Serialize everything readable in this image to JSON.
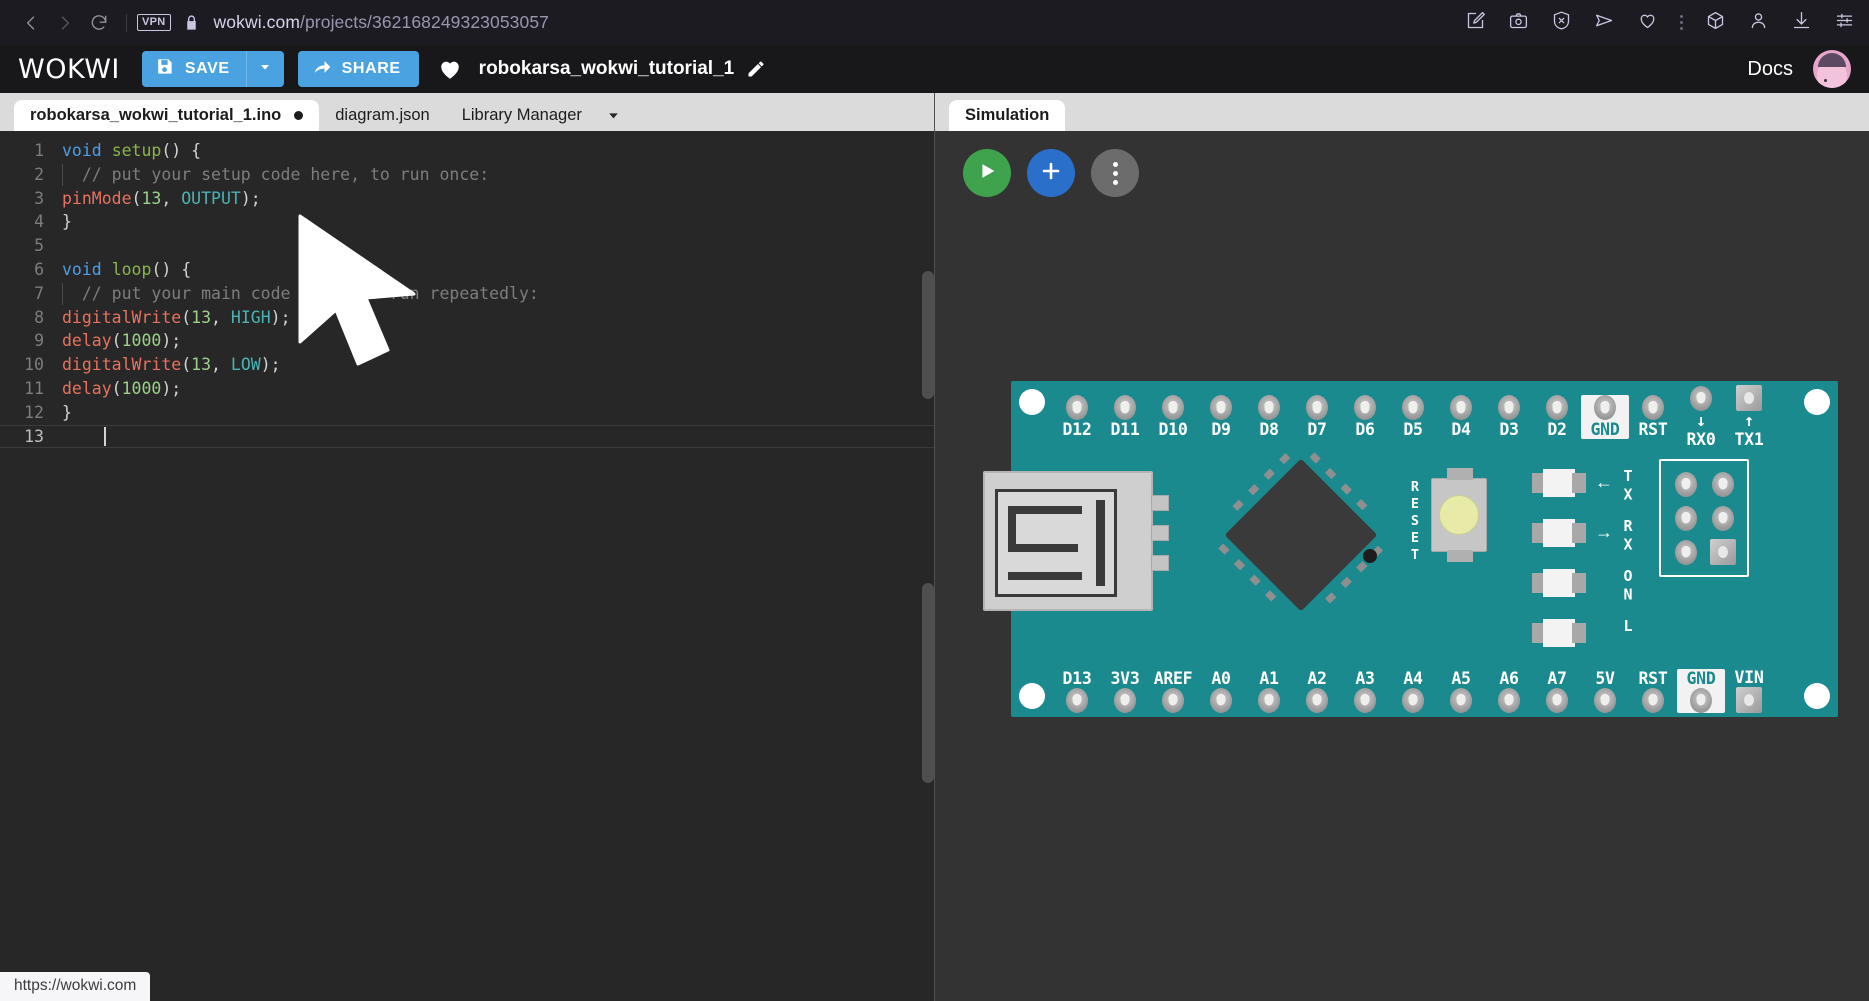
{
  "browser": {
    "url_prefix": "wokwi.com",
    "url_path": "/projects/362168249323053057",
    "vpn_badge": "VPN",
    "back_icon": "back-arrow-icon",
    "forward_icon": "forward-arrow-icon",
    "reload_icon": "reload-icon",
    "lock_icon": "lock-icon",
    "toolbar_icons": [
      "bookmark-edit-icon",
      "camera-icon",
      "blocked-circle-icon",
      "send-icon",
      "heart-icon",
      "overflow-dots-icon",
      "cube-icon",
      "account-icon",
      "download-icon",
      "settings-sliders-icon"
    ],
    "status_url": "https://wokwi.com"
  },
  "header": {
    "logo": "WOKWI",
    "save_label": "SAVE",
    "save_icon": "floppy-disk-icon",
    "save_caret_icon": "chevron-down-icon",
    "share_label": "SHARE",
    "share_icon": "share-arrow-icon",
    "favorite_icon": "heart-filled-icon",
    "project_title": "robokarsa_wokwi_tutorial_1",
    "edit_icon": "pencil-icon",
    "docs_label": "Docs",
    "avatar": "user-avatar"
  },
  "editor_tabs": {
    "items": [
      {
        "label": "robokarsa_wokwi_tutorial_1.ino",
        "active": true,
        "dirty": true
      },
      {
        "label": "diagram.json",
        "active": false,
        "dirty": false
      },
      {
        "label": "Library Manager",
        "active": false,
        "dirty": false
      }
    ],
    "overflow_icon": "chevron-down-icon"
  },
  "code": {
    "lines": [
      {
        "n": "1",
        "tokens": [
          {
            "t": "void",
            "c": "kw"
          },
          {
            "t": " ",
            "c": "pln"
          },
          {
            "t": "setup",
            "c": "fn"
          },
          {
            "t": "() {",
            "c": "pln"
          }
        ]
      },
      {
        "n": "2",
        "indent": true,
        "tokens": [
          {
            "t": "  // put your setup code here, to run once:",
            "c": "cmt"
          }
        ]
      },
      {
        "n": "3",
        "tokens": [
          {
            "t": "pinMode",
            "c": "call"
          },
          {
            "t": "(",
            "c": "pln"
          },
          {
            "t": "13",
            "c": "num"
          },
          {
            "t": ", ",
            "c": "pln"
          },
          {
            "t": "OUTPUT",
            "c": "cst"
          },
          {
            "t": ");",
            "c": "pln"
          }
        ]
      },
      {
        "n": "4",
        "tokens": [
          {
            "t": "}",
            "c": "pln"
          }
        ]
      },
      {
        "n": "5",
        "tokens": []
      },
      {
        "n": "6",
        "tokens": [
          {
            "t": "void",
            "c": "kw"
          },
          {
            "t": " ",
            "c": "pln"
          },
          {
            "t": "loop",
            "c": "fn"
          },
          {
            "t": "() {",
            "c": "pln"
          }
        ]
      },
      {
        "n": "7",
        "indent": true,
        "tokens": [
          {
            "t": "  // put your main code here, to run repeatedly:",
            "c": "cmt"
          }
        ]
      },
      {
        "n": "8",
        "tokens": [
          {
            "t": "digitalWrite",
            "c": "call"
          },
          {
            "t": "(",
            "c": "pln"
          },
          {
            "t": "13",
            "c": "num"
          },
          {
            "t": ", ",
            "c": "pln"
          },
          {
            "t": "HIGH",
            "c": "cst"
          },
          {
            "t": ");",
            "c": "pln"
          }
        ]
      },
      {
        "n": "9",
        "tokens": [
          {
            "t": "delay",
            "c": "call"
          },
          {
            "t": "(",
            "c": "pln"
          },
          {
            "t": "1000",
            "c": "num"
          },
          {
            "t": ");",
            "c": "pln"
          }
        ]
      },
      {
        "n": "10",
        "tokens": [
          {
            "t": "digitalWrite",
            "c": "call"
          },
          {
            "t": "(",
            "c": "pln"
          },
          {
            "t": "13",
            "c": "num"
          },
          {
            "t": ", ",
            "c": "pln"
          },
          {
            "t": "LOW",
            "c": "cst"
          },
          {
            "t": ");",
            "c": "pln"
          }
        ]
      },
      {
        "n": "11",
        "tokens": [
          {
            "t": "delay",
            "c": "call"
          },
          {
            "t": "(",
            "c": "pln"
          },
          {
            "t": "1000",
            "c": "num"
          },
          {
            "t": ");",
            "c": "pln"
          }
        ]
      },
      {
        "n": "12",
        "tokens": [
          {
            "t": "}",
            "c": "pln"
          }
        ]
      },
      {
        "n": "13",
        "current": true,
        "tokens": []
      }
    ]
  },
  "simulation": {
    "tab_label": "Simulation",
    "play_icon": "play-triangle-icon",
    "add_icon": "plus-icon",
    "more_icon": "vertical-dots-icon",
    "board": {
      "name": "arduino-nano",
      "top_pins": [
        {
          "label": "D12"
        },
        {
          "label": "D11"
        },
        {
          "label": "D10"
        },
        {
          "label": "D9"
        },
        {
          "label": "D8"
        },
        {
          "label": "D7"
        },
        {
          "label": "D6"
        },
        {
          "label": "D5"
        },
        {
          "label": "D4"
        },
        {
          "label": "D3"
        },
        {
          "label": "D2"
        },
        {
          "label": "GND",
          "highlight": true
        },
        {
          "label": "RST"
        },
        {
          "label": "↓",
          "sub": "RX0"
        },
        {
          "label": "↑",
          "sub": "TX1",
          "square": true
        }
      ],
      "bottom_pins": [
        {
          "label": "D13"
        },
        {
          "label": "3V3"
        },
        {
          "label": "AREF"
        },
        {
          "label": "A0"
        },
        {
          "label": "A1"
        },
        {
          "label": "A2"
        },
        {
          "label": "A3"
        },
        {
          "label": "A4"
        },
        {
          "label": "A5"
        },
        {
          "label": "A6"
        },
        {
          "label": "A7"
        },
        {
          "label": "5V"
        },
        {
          "label": "RST"
        },
        {
          "label": "GND",
          "highlight": true
        },
        {
          "label": "VIN",
          "square": true
        }
      ],
      "reset_label": "RESET",
      "leds": [
        {
          "name": "TX",
          "arrow": "←"
        },
        {
          "name": "RX",
          "arrow": "→"
        },
        {
          "name": "ON",
          "arrow": ""
        },
        {
          "name": "L",
          "arrow": ""
        }
      ]
    }
  },
  "colors": {
    "accent_blue": "#4aa3e0",
    "board_teal": "#1a8a8f",
    "play_green": "#3fa34d",
    "add_blue": "#2a6fc9",
    "editor_bg": "#272727",
    "sim_bg": "#333333"
  }
}
